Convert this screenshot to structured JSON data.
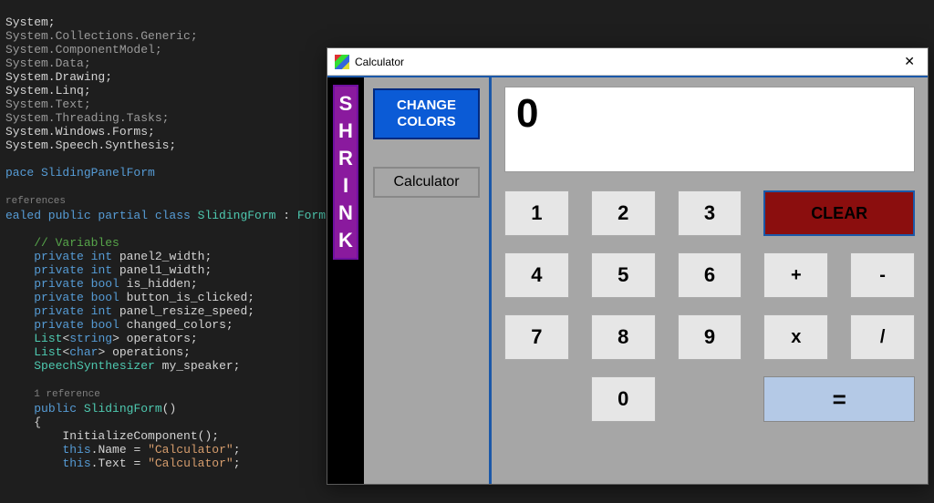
{
  "code": {
    "lines": [
      {
        "raw": "System;",
        "cls": ""
      },
      {
        "raw": "System.Collections.Generic;",
        "cls": "pale"
      },
      {
        "raw": "System.ComponentModel;",
        "cls": "pale"
      },
      {
        "raw": "System.Data;",
        "cls": "pale"
      },
      {
        "raw": "System.Drawing;",
        "cls": ""
      },
      {
        "raw": "System.Linq;",
        "cls": ""
      },
      {
        "raw": "System.Text;",
        "cls": "pale"
      },
      {
        "raw": "System.Threading.Tasks;",
        "cls": "pale"
      },
      {
        "raw": "System.Windows.Forms;",
        "cls": ""
      },
      {
        "raw": "System.Speech.Synthesis;",
        "cls": ""
      }
    ],
    "namespace_line": "pace SlidingPanelForm",
    "refs1": "references",
    "class_decl": {
      "mods": "ealed public partial class ",
      "name": "SlidingForm",
      "rest": " : ",
      "base": "Form"
    },
    "vars_comment": "// Variables",
    "fields": [
      {
        "mods": "private",
        "type": "int",
        "name": "panel2_width;"
      },
      {
        "mods": "private",
        "type": "int",
        "name": "panel1_width;"
      },
      {
        "mods": "private",
        "type": "bool",
        "name": "is_hidden;"
      },
      {
        "mods": "private",
        "type": "bool",
        "name": "button_is_clicked;"
      },
      {
        "mods": "private",
        "type": "int",
        "name": "panel_resize_speed;"
      },
      {
        "mods": "private",
        "type": "bool",
        "name": "changed_colors;"
      }
    ],
    "list1": {
      "type": "List",
      "gen": "string",
      "name": "operators;"
    },
    "list2": {
      "type": "List",
      "gen": "char",
      "name": "operations;"
    },
    "synth": {
      "type": "SpeechSynthesizer",
      "name": "my_speaker;"
    },
    "refs2": "1 reference",
    "ctor": {
      "mods": "public",
      "name": "SlidingForm",
      "paren": "()"
    },
    "brace_open": "{",
    "init_call": "    InitializeComponent();",
    "name_assign": {
      "pre": "    ",
      "this": "this",
      "dot": ".Name = ",
      "str": "\"Calculator\"",
      "semi": ";"
    },
    "text_assign": {
      "pre": "    ",
      "this": "this",
      "dot": ".Text = ",
      "str": "\"Calculator\"",
      "semi": ";"
    }
  },
  "window": {
    "title": "Calculator"
  },
  "left_panel": {
    "shrink_letters": [
      "S",
      "H",
      "R",
      "I",
      "N",
      "K"
    ],
    "change_colors": "CHANGE COLORS",
    "calculator": "Calculator"
  },
  "calc": {
    "display": "0",
    "keys": {
      "n1": "1",
      "n2": "2",
      "n3": "3",
      "n4": "4",
      "n5": "5",
      "n6": "6",
      "n7": "7",
      "n8": "8",
      "n9": "9",
      "n0": "0",
      "clear": "CLEAR",
      "plus": "+",
      "minus": "-",
      "mult": "x",
      "div": "/",
      "equals": "="
    }
  }
}
